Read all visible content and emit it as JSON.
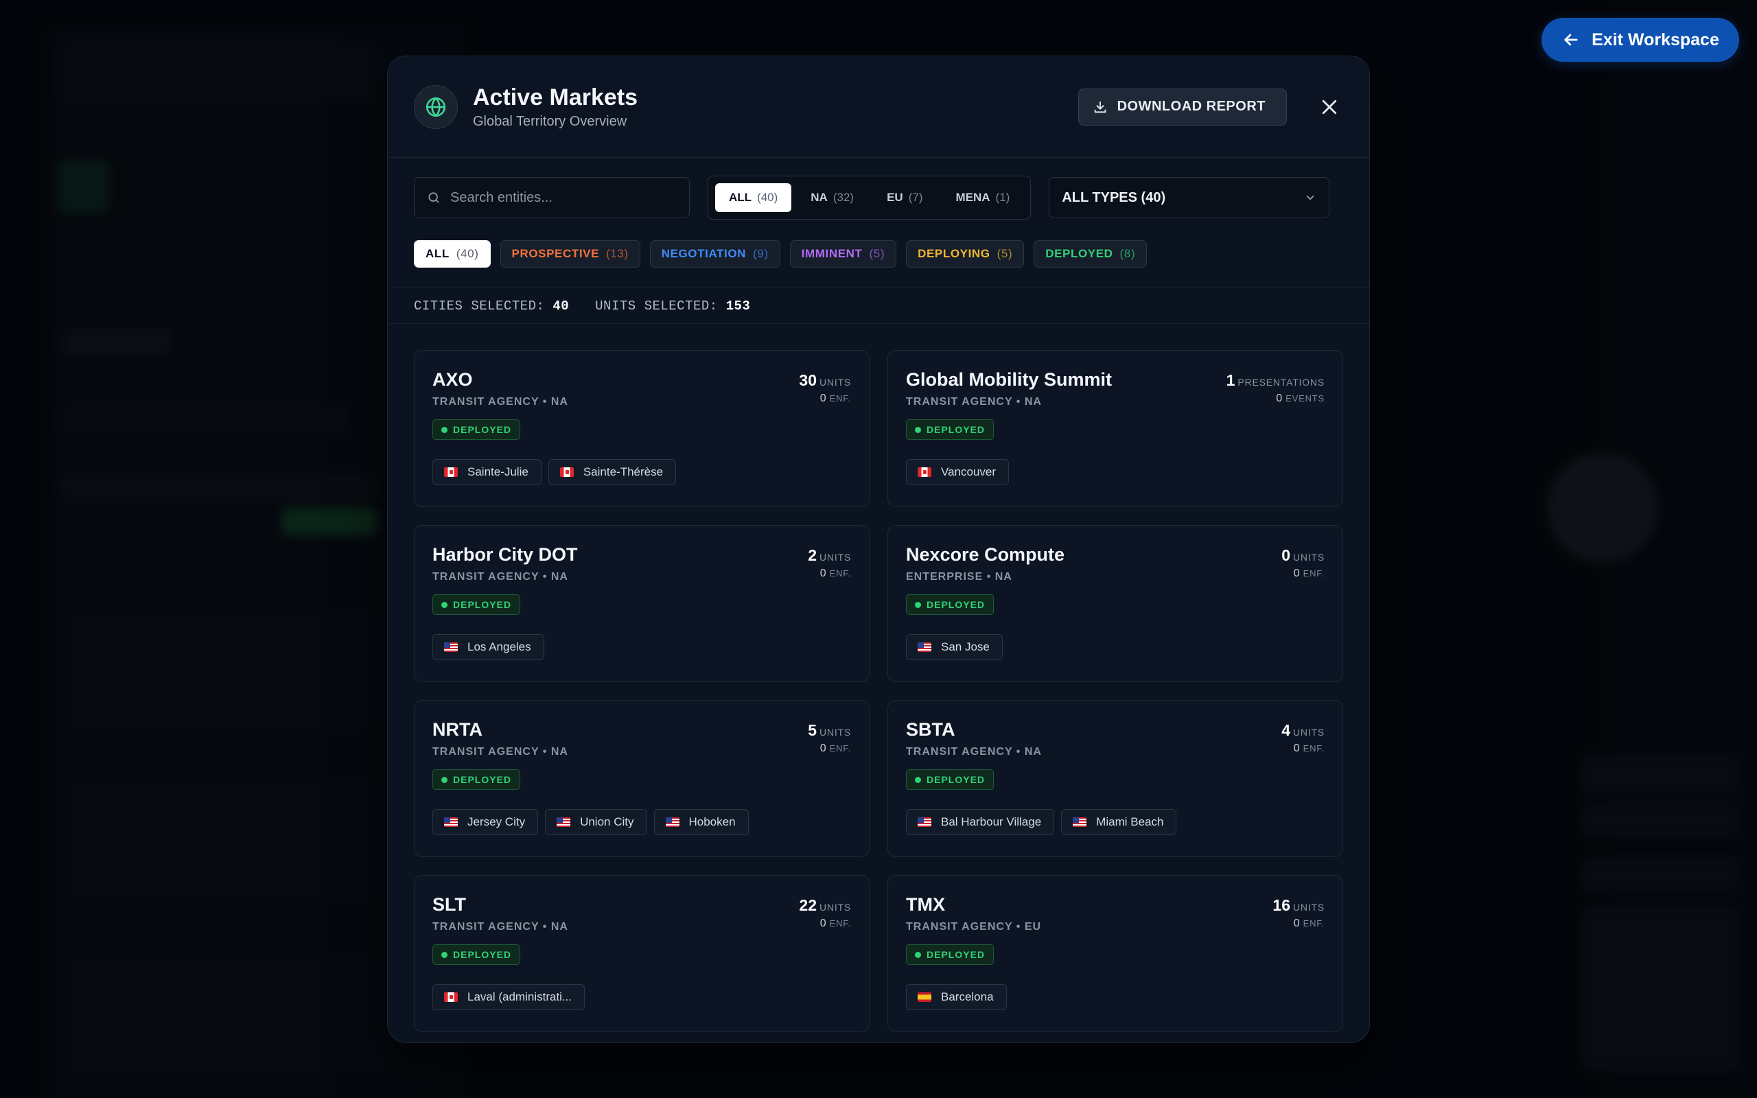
{
  "exit_button": {
    "label": "Exit Workspace"
  },
  "modal": {
    "title": "Active Markets",
    "subtitle": "Global Territory Overview",
    "download_label": "DOWNLOAD REPORT"
  },
  "search": {
    "placeholder": "Search entities...",
    "value": ""
  },
  "region_tabs": [
    {
      "label": "ALL",
      "count": "(40)",
      "active": true
    },
    {
      "label": "NA",
      "count": "(32)",
      "active": false
    },
    {
      "label": "EU",
      "count": "(7)",
      "active": false
    },
    {
      "label": "MENA",
      "count": "(1)",
      "active": false
    }
  ],
  "type_select": {
    "value": "ALL TYPES (40)"
  },
  "status_filters": [
    {
      "label": "ALL",
      "count": "(40)",
      "active": true,
      "color": "#0b1220"
    },
    {
      "label": "PROSPECTIVE",
      "count": "(13)",
      "active": false,
      "color": "#f5733a"
    },
    {
      "label": "NEGOTIATION",
      "count": "(9)",
      "active": false,
      "color": "#3f8cf7"
    },
    {
      "label": "IMMINENT",
      "count": "(5)",
      "active": false,
      "color": "#b46cf5"
    },
    {
      "label": "DEPLOYING",
      "count": "(5)",
      "active": false,
      "color": "#f2b632"
    },
    {
      "label": "DEPLOYED",
      "count": "(8)",
      "active": false,
      "color": "#2fd37a"
    }
  ],
  "selection": {
    "cities_label": "CITIES SELECTED:",
    "cities_value": "40",
    "units_label": "UNITS SELECTED:",
    "units_value": "153"
  },
  "cards": [
    {
      "name": "AXO",
      "meta": "TRANSIT AGENCY • NA",
      "main_value": "30",
      "main_unit": "UNITS",
      "sub_value": "0",
      "sub_unit": "ENF.",
      "status": "DEPLOYED",
      "cities": [
        {
          "flag": "ca",
          "name": "Sainte-Julie"
        },
        {
          "flag": "ca",
          "name": "Sainte-Thérèse"
        }
      ]
    },
    {
      "name": "Global Mobility Summit",
      "meta": "TRANSIT AGENCY • NA",
      "main_value": "1",
      "main_unit": "PRESENTATIONS",
      "sub_value": "0",
      "sub_unit": "EVENTS",
      "status": "DEPLOYED",
      "cities": [
        {
          "flag": "ca",
          "name": "Vancouver"
        }
      ]
    },
    {
      "name": "Harbor City DOT",
      "meta": "TRANSIT AGENCY • NA",
      "main_value": "2",
      "main_unit": "UNITS",
      "sub_value": "0",
      "sub_unit": "ENF.",
      "status": "DEPLOYED",
      "cities": [
        {
          "flag": "us",
          "name": "Los Angeles"
        }
      ]
    },
    {
      "name": "Nexcore Compute",
      "meta": "ENTERPRISE • NA",
      "main_value": "0",
      "main_unit": "UNITS",
      "sub_value": "0",
      "sub_unit": "ENF.",
      "status": "DEPLOYED",
      "cities": [
        {
          "flag": "us",
          "name": "San Jose"
        }
      ]
    },
    {
      "name": "NRTA",
      "meta": "TRANSIT AGENCY • NA",
      "main_value": "5",
      "main_unit": "UNITS",
      "sub_value": "0",
      "sub_unit": "ENF.",
      "status": "DEPLOYED",
      "cities": [
        {
          "flag": "us",
          "name": "Jersey City"
        },
        {
          "flag": "us",
          "name": "Union City"
        },
        {
          "flag": "us",
          "name": "Hoboken"
        }
      ]
    },
    {
      "name": "SBTA",
      "meta": "TRANSIT AGENCY • NA",
      "main_value": "4",
      "main_unit": "UNITS",
      "sub_value": "0",
      "sub_unit": "ENF.",
      "status": "DEPLOYED",
      "cities": [
        {
          "flag": "us",
          "name": "Bal Harbour Village"
        },
        {
          "flag": "us",
          "name": "Miami Beach"
        }
      ]
    },
    {
      "name": "SLT",
      "meta": "TRANSIT AGENCY • NA",
      "main_value": "22",
      "main_unit": "UNITS",
      "sub_value": "0",
      "sub_unit": "ENF.",
      "status": "DEPLOYED",
      "cities": [
        {
          "flag": "ca",
          "name": "Laval (administrati..."
        }
      ]
    },
    {
      "name": "TMX",
      "meta": "TRANSIT AGENCY • EU",
      "main_value": "16",
      "main_unit": "UNITS",
      "sub_value": "0",
      "sub_unit": "ENF.",
      "status": "DEPLOYED",
      "cities": [
        {
          "flag": "es",
          "name": "Barcelona"
        }
      ]
    }
  ],
  "colors": {
    "accent_blue": "#0d52b3",
    "deployed_green": "#2fd37a",
    "globe_green": "#3ddc97"
  },
  "icons": {
    "globe": "globe-icon",
    "download": "download-icon",
    "close": "close-icon",
    "search": "search-icon",
    "chevron": "chevron-down-icon",
    "back_arrow": "arrow-left-icon"
  }
}
